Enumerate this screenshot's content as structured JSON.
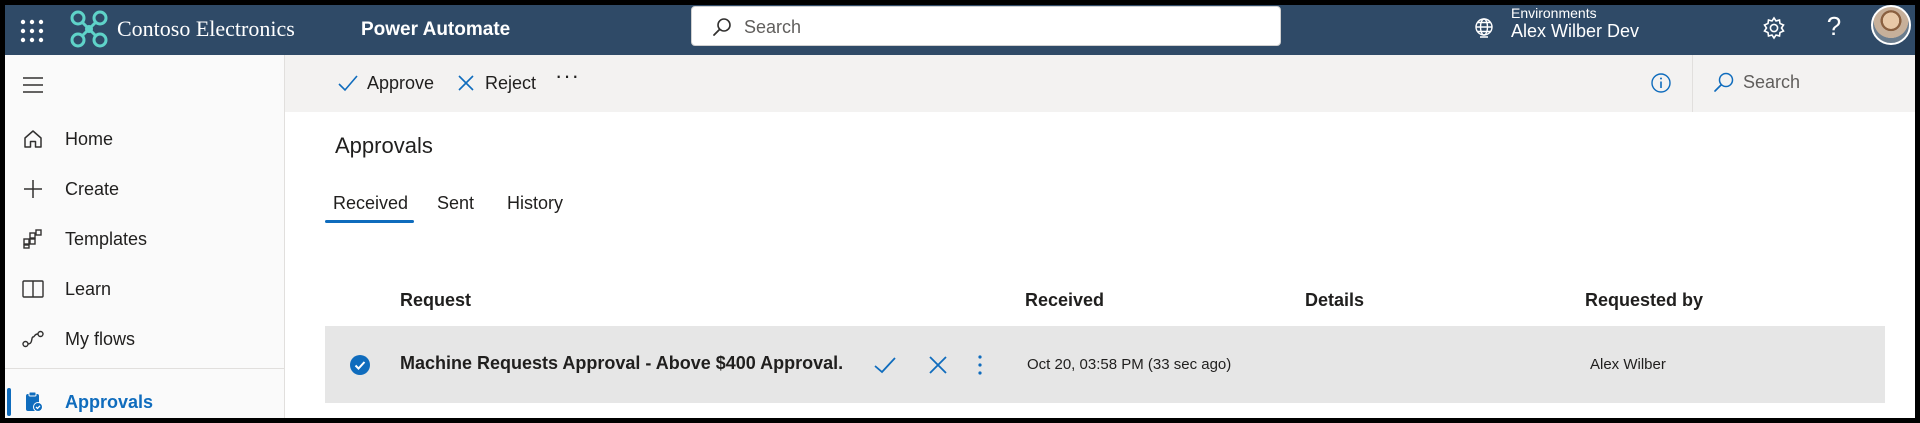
{
  "colors": {
    "header_bg": "#2f4a67",
    "accent": "#0f6cbd",
    "command_bar_bg": "#f3f2f1",
    "selected_row_bg": "#e6e6e6"
  },
  "header": {
    "company_name": "Contoso Electronics",
    "app_name": "Power Automate",
    "search_placeholder": "Search",
    "environment_label": "Environments",
    "environment_name": "Alex Wilber Dev",
    "icons": [
      "waffle-icon",
      "contoso-logo-icon",
      "search-icon",
      "globe-icon",
      "gear-icon",
      "help-icon",
      "avatar"
    ]
  },
  "sidebar": {
    "items": [
      {
        "label": "Home",
        "icon": "home-icon"
      },
      {
        "label": "Create",
        "icon": "plus-icon"
      },
      {
        "label": "Templates",
        "icon": "templates-icon"
      },
      {
        "label": "Learn",
        "icon": "book-icon"
      },
      {
        "label": "My flows",
        "icon": "flows-icon"
      },
      {
        "label": "Approvals",
        "icon": "approvals-icon",
        "active": true
      }
    ]
  },
  "command_bar": {
    "approve_label": "Approve",
    "reject_label": "Reject",
    "more_label": "···",
    "search_label": "Search"
  },
  "main": {
    "title": "Approvals",
    "tabs": [
      {
        "label": "Received",
        "selected": true
      },
      {
        "label": "Sent"
      },
      {
        "label": "History"
      }
    ],
    "table": {
      "columns": [
        "Request",
        "Received",
        "Details",
        "Requested by"
      ],
      "rows": [
        {
          "selected": true,
          "request": "Machine Requests Approval - Above $400 Approval.",
          "received": "Oct 20, 03:58 PM (33 sec ago)",
          "details": "",
          "requested_by": "Alex Wilber"
        }
      ]
    }
  }
}
